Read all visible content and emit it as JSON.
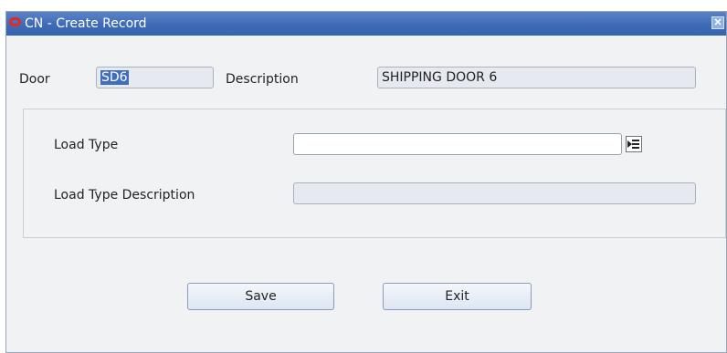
{
  "window": {
    "title": "CN - Create Record",
    "close_glyph": "✕"
  },
  "header": {
    "door_label": "Door",
    "door_value": "SD6",
    "description_label": "Description",
    "description_value": "SHIPPING DOOR 6"
  },
  "form": {
    "load_type_label": "Load Type",
    "load_type_value": "",
    "load_type_description_label": "Load Type Description",
    "load_type_description_value": ""
  },
  "buttons": {
    "save_label": "Save",
    "exit_label": "Exit"
  },
  "icons": {
    "app_logo": "oracle-logo-icon",
    "close": "close-icon",
    "list_of_values": "list-of-values-icon"
  },
  "colors": {
    "titlebar": "#3f6bb6",
    "selection": "#3f6ec0",
    "logo_red": "#e8281e"
  }
}
